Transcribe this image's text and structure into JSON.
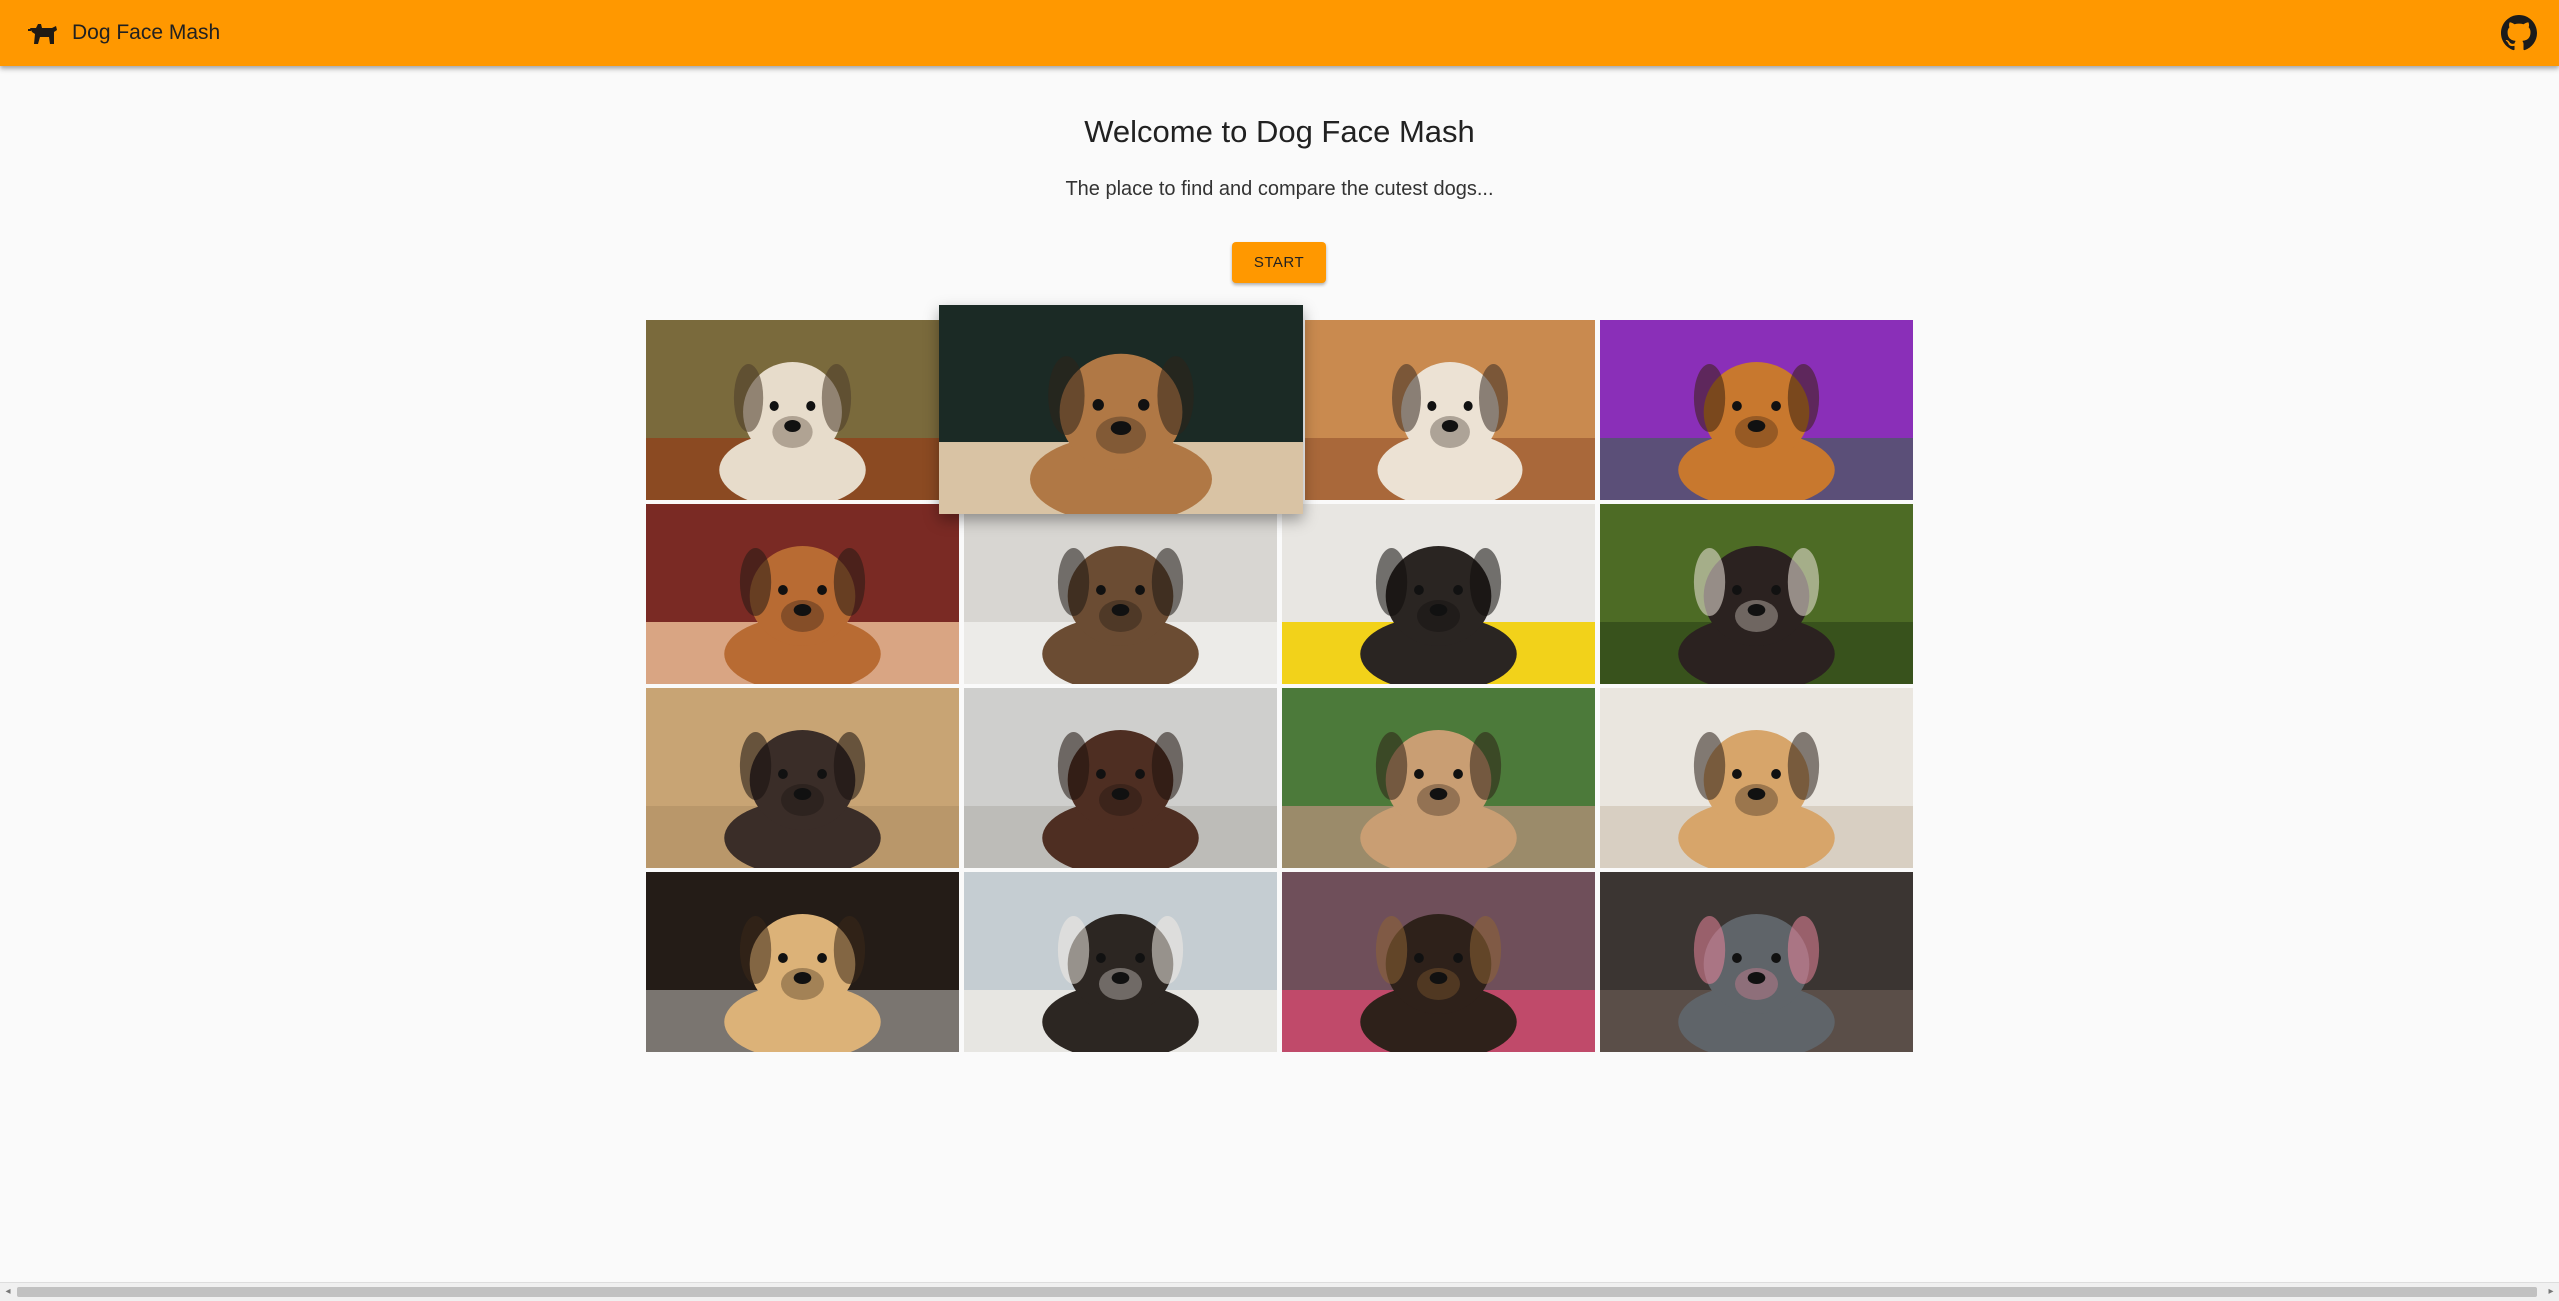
{
  "appbar": {
    "title": "Dog Face Mash",
    "logo_icon": "dog-icon",
    "github_icon": "github-icon",
    "color": "#ff9800"
  },
  "hero": {
    "heading": "Welcome to Dog Face Mash",
    "subtitle": "The place to find and compare the cutest dogs...",
    "start_label": "START"
  },
  "gallery": {
    "dogs": [
      {
        "bg": "#7a6a3c",
        "ground": "#8b4a22",
        "dog": "#e7dccb",
        "face": "#4a3a2a"
      },
      {
        "bg": "#1b2a25",
        "ground": "#d9c3a4",
        "dog": "#b07845",
        "face": "#2e2219"
      },
      {
        "bg": "#c98a4f",
        "ground": "#a9683a",
        "dog": "#ece2d4",
        "face": "#3a2e26"
      },
      {
        "bg": "#8a2fb8",
        "ground": "#5b4f78",
        "dog": "#c8782e",
        "face": "#3b2110"
      },
      {
        "bg": "#7a2a24",
        "ground": "#d9a583",
        "dog": "#b86b33",
        "face": "#241a14"
      },
      {
        "bg": "#d8d6d2",
        "ground": "#ecebe8",
        "dog": "#6b4c33",
        "face": "#1e1712"
      },
      {
        "bg": "#e8e6e2",
        "ground": "#f2d21a",
        "dog": "#2a2522",
        "face": "#0e0c0b"
      },
      {
        "bg": "#4d6b25",
        "ground": "#38521c",
        "dog": "#2b2220",
        "face": "#efe6dd"
      },
      {
        "bg": "#c8a474",
        "ground": "#b9976a",
        "dog": "#3a2d28",
        "face": "#18110e"
      },
      {
        "bg": "#cfcfcd",
        "ground": "#bdbcb8",
        "dog": "#4e2e22",
        "face": "#1d120d"
      },
      {
        "bg": "#4c7a3a",
        "ground": "#9b8b6a",
        "dog": "#c99e73",
        "face": "#2e2016"
      },
      {
        "bg": "#eae6df",
        "ground": "#d8cfc2",
        "dog": "#d7a56a",
        "face": "#2a1f17"
      },
      {
        "bg": "#241c17",
        "ground": "#7a7570",
        "dog": "#dcb278",
        "face": "#3a2818"
      },
      {
        "bg": "#c5cdd2",
        "ground": "#e7e6e2",
        "dog": "#2c2622",
        "face": "#f0ebe4"
      },
      {
        "bg": "#6f4f5a",
        "ground": "#c04a6a",
        "dog": "#2e211a",
        "face": "#8e6535"
      },
      {
        "bg": "#3b3532",
        "ground": "#5a4e48",
        "dog": "#5f6469",
        "face": "#e8849a"
      }
    ]
  }
}
